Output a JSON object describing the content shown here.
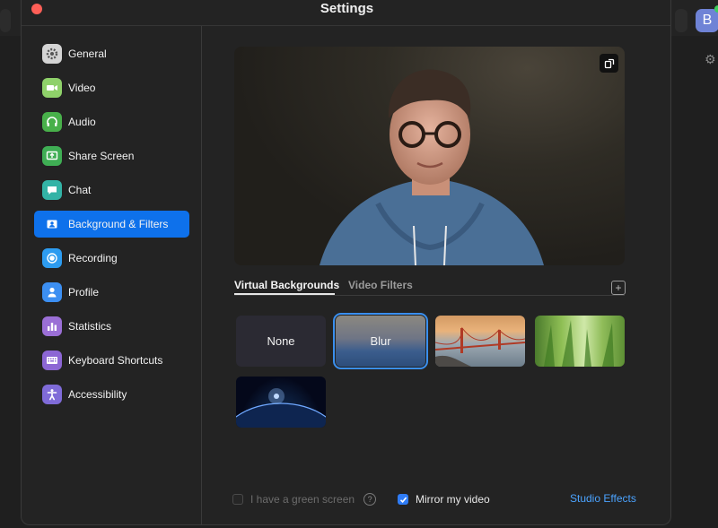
{
  "window": {
    "title": "Settings"
  },
  "background_app": {
    "avatar_initial": "B"
  },
  "sidebar": {
    "items": [
      {
        "label": "General",
        "icon": "gear-icon",
        "color": "#cfcfcf",
        "active": false
      },
      {
        "label": "Video",
        "icon": "video-camera-icon",
        "color": "#8fd16a",
        "active": false
      },
      {
        "label": "Audio",
        "icon": "headphones-icon",
        "color": "#48b04a",
        "active": false
      },
      {
        "label": "Share Screen",
        "icon": "share-screen-icon",
        "color": "#3fae54",
        "active": false
      },
      {
        "label": "Chat",
        "icon": "chat-bubble-icon",
        "color": "#33b3a6",
        "active": false
      },
      {
        "label": "Background & Filters",
        "icon": "portrait-icon",
        "color": "#0e71eb",
        "active": true
      },
      {
        "label": "Recording",
        "icon": "record-icon",
        "color": "#2d9cf0",
        "active": false
      },
      {
        "label": "Profile",
        "icon": "user-icon",
        "color": "#3c8ff2",
        "active": false
      },
      {
        "label": "Statistics",
        "icon": "bar-chart-icon",
        "color": "#9b6fd6",
        "active": false
      },
      {
        "label": "Keyboard Shortcuts",
        "icon": "keyboard-icon",
        "color": "#8c66d4",
        "active": false
      },
      {
        "label": "Accessibility",
        "icon": "accessibility-icon",
        "color": "#7f6bd8",
        "active": false
      }
    ]
  },
  "tabs": [
    {
      "label": "Virtual Backgrounds",
      "active": true
    },
    {
      "label": "Video Filters",
      "active": false
    }
  ],
  "backgrounds": [
    {
      "label": "None",
      "kind": "none",
      "selected": false
    },
    {
      "label": "Blur",
      "kind": "blur",
      "selected": true
    },
    {
      "label": "",
      "kind": "golden-gate-bridge",
      "selected": false
    },
    {
      "label": "",
      "kind": "grass",
      "selected": false
    },
    {
      "label": "",
      "kind": "earth-from-space",
      "selected": false
    }
  ],
  "footer": {
    "green_screen_label": "I have a green screen",
    "green_screen_checked": false,
    "mirror_label": "Mirror my video",
    "mirror_checked": true,
    "studio_effects_label": "Studio Effects"
  }
}
